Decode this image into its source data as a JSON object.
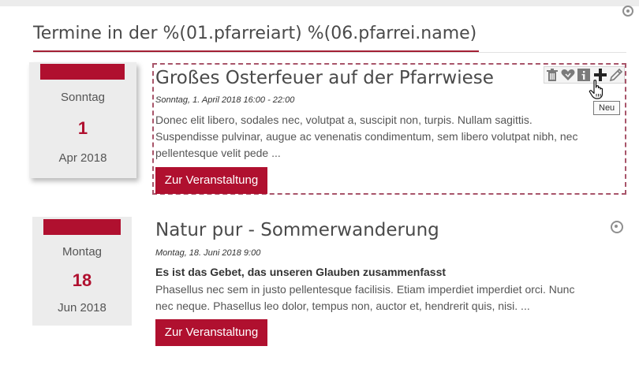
{
  "header": {
    "title": "Termine in der %(01.pfarreiart) %(06.pfarrei.name)"
  },
  "colors": {
    "accent": "#b0102f",
    "datebox_bg": "#ececec",
    "dashed_border": "#a8556a"
  },
  "events": [
    {
      "weekday": "Sonntag",
      "day": "1",
      "month_year": "Apr 2018",
      "title": "Großes Osterfeuer auf der Pfarrwiese",
      "datetime": "Sonntag, 1. April 2018 16:00 - 22:00",
      "text_lines": [
        "Donec elit libero, sodales nec, volutpat a, suscipit non, turpis. Nullam sagittis.",
        "Suspendisse pulvinar, augue ac venenatis condimentum, sem libero volutpat nibh, nec",
        "pellentesque velit pede ..."
      ],
      "button_label": "Zur Veranstaltung"
    },
    {
      "weekday": "Montag",
      "day": "18",
      "month_year": "Jun 2018",
      "title": "Natur pur - Sommerwanderung",
      "datetime": "Montag, 18. Juni 2018 9:00",
      "subtitle": "Es ist das Gebet, das unseren Glauben zusammenfasst",
      "text_lines": [
        "Phasellus nec sem in justo pellentesque facilisis. Etiam imperdiet imperdiet orci. Nunc",
        "nec neque. Phasellus leo dolor, tempus non, auctor et, hendrerit quis, nisi. ..."
      ],
      "button_label": "Zur Veranstaltung"
    }
  ],
  "edit_toolbar": {
    "icons": [
      "trash-icon",
      "heart-icon",
      "info-icon",
      "plus-icon",
      "pencil-icon"
    ],
    "tooltip": "Neu"
  }
}
